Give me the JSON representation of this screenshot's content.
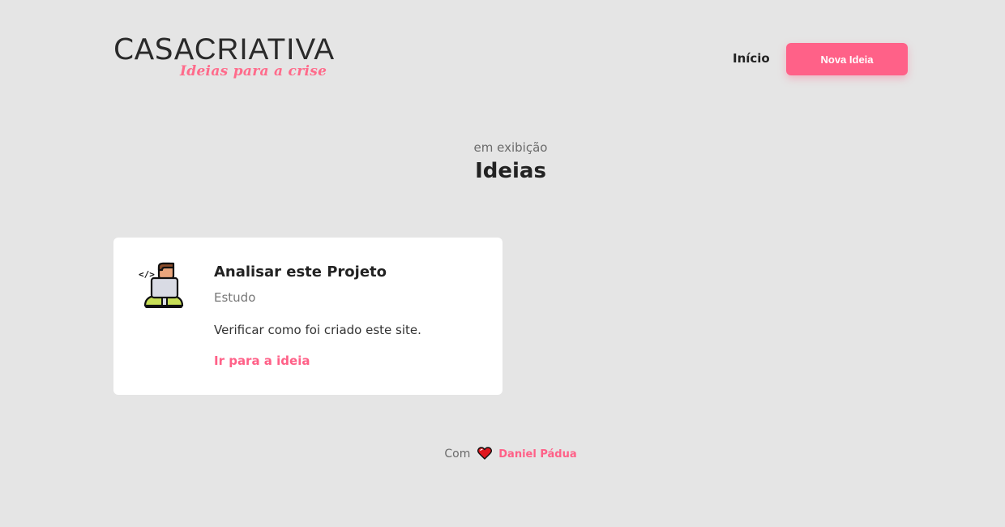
{
  "header": {
    "logo_casa": "CASA",
    "logo_criativa": "CRIATIVA",
    "logo_tagline": "Ideias para a crise",
    "nav_home": "Início",
    "new_idea_button": "Nova Ideia"
  },
  "section": {
    "subtitle": "em exibição",
    "title": "Ideias"
  },
  "ideas": [
    {
      "title": "Analisar este Projeto",
      "category": "Estudo",
      "description": "Verificar como foi criado este site.",
      "link_label": "Ir para a ideia",
      "icon": "developer-icon"
    }
  ],
  "footer": {
    "prefix": "Com",
    "icon": "heart-icon",
    "author": "Daniel Pádua"
  },
  "colors": {
    "background": "#e5e5e5",
    "accent": "#ff6188",
    "text": "#222222",
    "card": "#ffffff"
  }
}
